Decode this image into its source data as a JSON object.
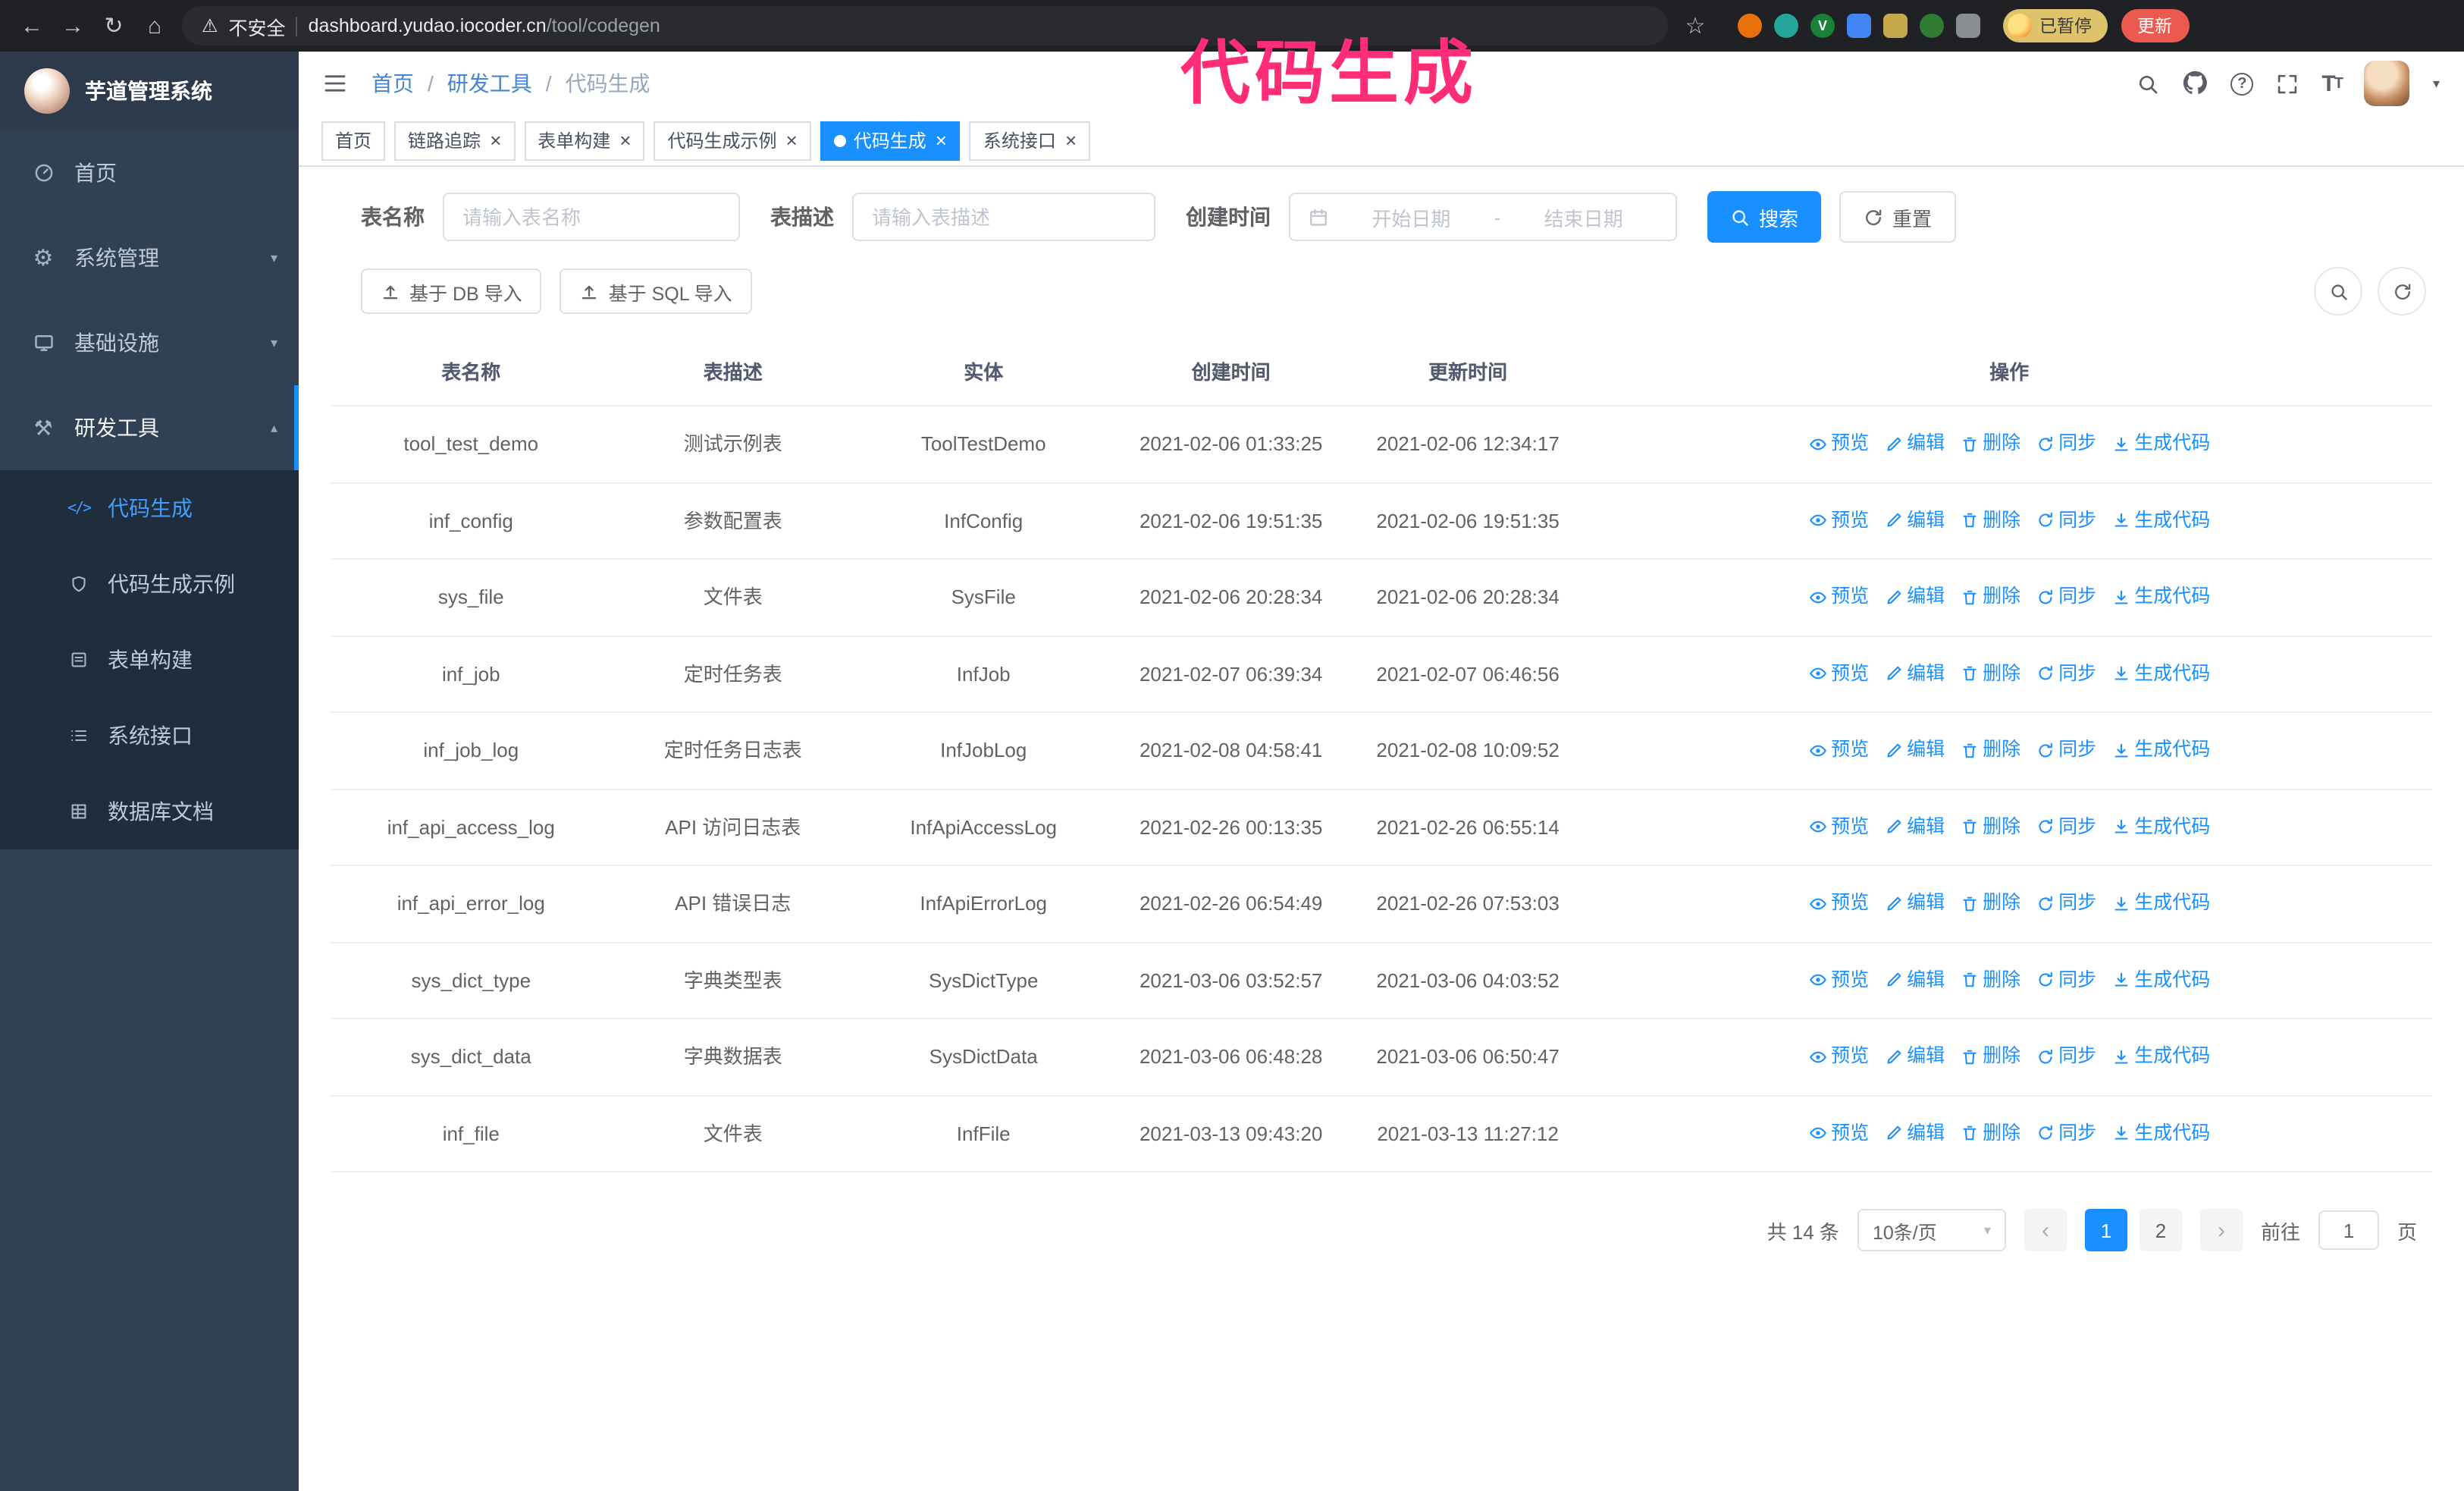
{
  "chrome": {
    "security_label": "不安全",
    "url_host": "dashboard.yudao.iocoder.cn",
    "url_path": "/tool/codegen",
    "paused_badge": "已暂停",
    "update_button": "更新"
  },
  "annotation": {
    "text": "代码生成",
    "color": "#ff2d78"
  },
  "sidebar": {
    "logo_title": "芋道管理系统",
    "items": [
      {
        "label": "首页",
        "expandable": false,
        "state": "none"
      },
      {
        "label": "系统管理",
        "expandable": true,
        "state": "collapsed"
      },
      {
        "label": "基础设施",
        "expandable": true,
        "state": "collapsed"
      },
      {
        "label": "研发工具",
        "expandable": true,
        "state": "expanded"
      }
    ],
    "submenu": [
      {
        "label": "代码生成",
        "active": true
      },
      {
        "label": "代码生成示例",
        "active": false
      },
      {
        "label": "表单构建",
        "active": false
      },
      {
        "label": "系统接口",
        "active": false
      },
      {
        "label": "数据库文档",
        "active": false
      }
    ]
  },
  "header": {
    "breadcrumb": [
      "首页",
      "研发工具",
      "代码生成"
    ]
  },
  "tabs": [
    {
      "label": "首页",
      "active": false,
      "closable": false
    },
    {
      "label": "链路追踪",
      "active": false,
      "closable": true
    },
    {
      "label": "表单构建",
      "active": false,
      "closable": true
    },
    {
      "label": "代码生成示例",
      "active": false,
      "closable": true
    },
    {
      "label": "代码生成",
      "active": true,
      "closable": true
    },
    {
      "label": "系统接口",
      "active": false,
      "closable": true
    }
  ],
  "filters": {
    "table_name_label": "表名称",
    "table_name_placeholder": "请输入表名称",
    "table_desc_label": "表描述",
    "table_desc_placeholder": "请输入表描述",
    "create_time_label": "创建时间",
    "date_start_placeholder": "开始日期",
    "date_separator": "-",
    "date_end_placeholder": "结束日期",
    "search_button": "搜索",
    "reset_button": "重置"
  },
  "toolbar": {
    "import_db_button": "基于 DB 导入",
    "import_sql_button": "基于 SQL 导入"
  },
  "table": {
    "columns": [
      "表名称",
      "表描述",
      "实体",
      "创建时间",
      "更新时间",
      "操作"
    ],
    "actions": [
      "预览",
      "编辑",
      "删除",
      "同步",
      "生成代码"
    ],
    "rows": [
      {
        "name": "tool_test_demo",
        "desc": "测试示例表",
        "entity": "ToolTestDemo",
        "created": "2021-02-06 01:33:25",
        "updated": "2021-02-06 12:34:17"
      },
      {
        "name": "inf_config",
        "desc": "参数配置表",
        "entity": "InfConfig",
        "created": "2021-02-06 19:51:35",
        "updated": "2021-02-06 19:51:35"
      },
      {
        "name": "sys_file",
        "desc": "文件表",
        "entity": "SysFile",
        "created": "2021-02-06 20:28:34",
        "updated": "2021-02-06 20:28:34"
      },
      {
        "name": "inf_job",
        "desc": "定时任务表",
        "entity": "InfJob",
        "created": "2021-02-07 06:39:34",
        "updated": "2021-02-07 06:46:56"
      },
      {
        "name": "inf_job_log",
        "desc": "定时任务日志表",
        "entity": "InfJobLog",
        "created": "2021-02-08 04:58:41",
        "updated": "2021-02-08 10:09:52"
      },
      {
        "name": "inf_api_access_log",
        "desc": "API 访问日志表",
        "entity": "InfApiAccessLog",
        "created": "2021-02-26 00:13:35",
        "updated": "2021-02-26 06:55:14"
      },
      {
        "name": "inf_api_error_log",
        "desc": "API 错误日志",
        "entity": "InfApiErrorLog",
        "created": "2021-02-26 06:54:49",
        "updated": "2021-02-26 07:53:03"
      },
      {
        "name": "sys_dict_type",
        "desc": "字典类型表",
        "entity": "SysDictType",
        "created": "2021-03-06 03:52:57",
        "updated": "2021-03-06 04:03:52"
      },
      {
        "name": "sys_dict_data",
        "desc": "字典数据表",
        "entity": "SysDictData",
        "created": "2021-03-06 06:48:28",
        "updated": "2021-03-06 06:50:47"
      },
      {
        "name": "inf_file",
        "desc": "文件表",
        "entity": "InfFile",
        "created": "2021-03-13 09:43:20",
        "updated": "2021-03-13 11:27:12"
      }
    ]
  },
  "pagination": {
    "total": "共 14 条",
    "page_size": "10条/页",
    "pages": [
      "1",
      "2"
    ],
    "active_page": "1",
    "goto_label": "前往",
    "goto_value": "1",
    "goto_suffix": "页"
  },
  "colors": {
    "accent": "#1890ff",
    "sidebar_bg": "#304156",
    "submenu_bg": "#1f2d3d",
    "active_menu_text": "#409eff",
    "annotation": "#ff2d78"
  }
}
